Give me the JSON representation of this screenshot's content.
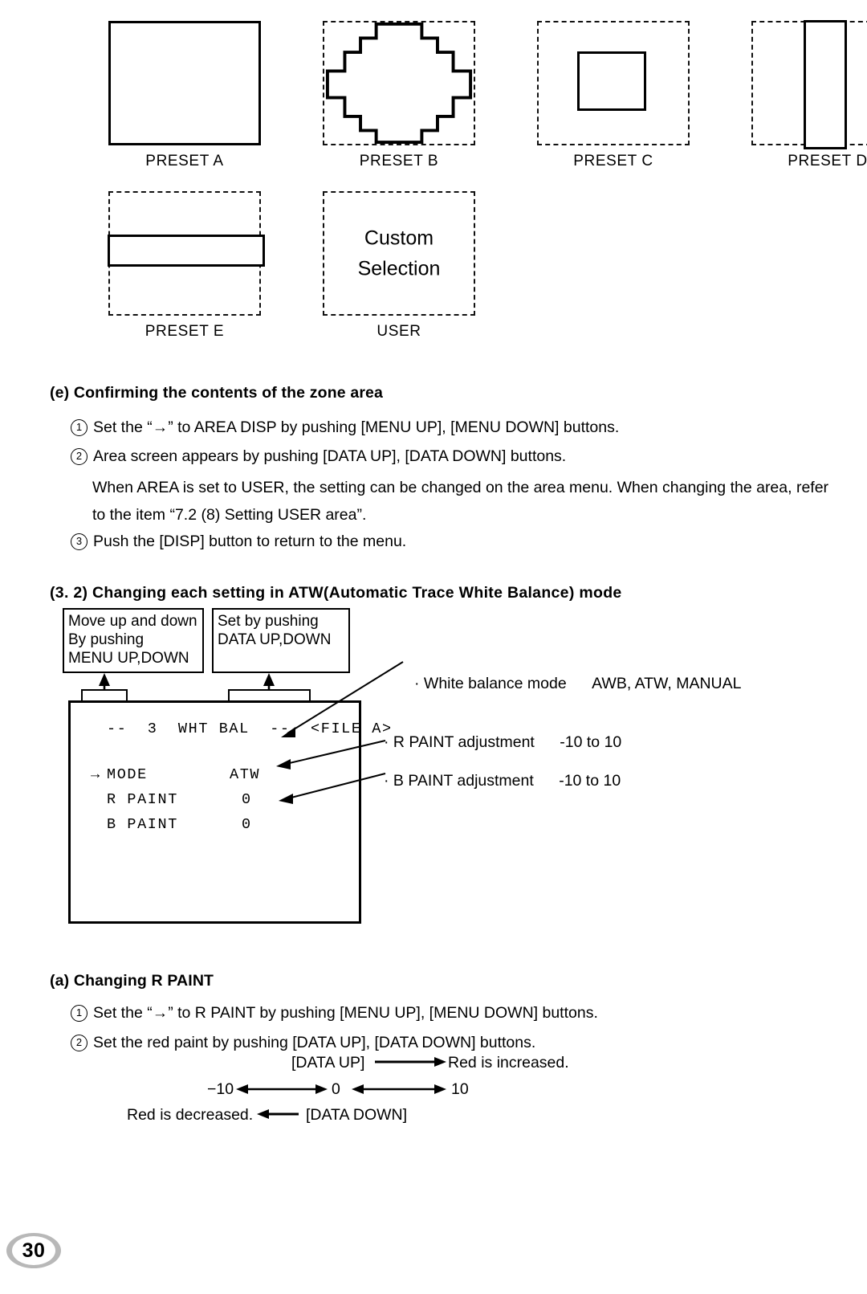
{
  "presets": {
    "row1": [
      {
        "label": "PRESET A",
        "shape": "full-frame"
      },
      {
        "label": "PRESET B",
        "shape": "stepped-octagon"
      },
      {
        "label": "PRESET C",
        "shape": "center-rect"
      },
      {
        "label": "PRESET D",
        "shape": "vertical-bar"
      }
    ],
    "row2": [
      {
        "label": "PRESET E",
        "shape": "horizontal-band"
      },
      {
        "label": "USER",
        "shape": "custom",
        "line1": "Custom",
        "line2": "Selection"
      }
    ]
  },
  "section_e": {
    "heading": "(e) Confirming the contents of the zone area",
    "items": [
      {
        "num": "1",
        "text": "Set the “→” to AREA DISP by pushing [MENU UP], [MENU DOWN] buttons."
      },
      {
        "num": "2",
        "text": "Area screen appears by pushing [DATA UP], [DATA DOWN] buttons."
      }
    ],
    "note_line1": "When AREA is set to USER, the setting can be changed on the area menu. When changing the area, refer",
    "note_line2": "to the item “7.2 (8) Setting USER area”.",
    "item3": {
      "num": "3",
      "text": "Push the [DISP] button to return to the menu."
    }
  },
  "section_32": {
    "heading": "(3. 2)  Changing each setting in ATW(Automatic Trace White Balance) mode",
    "callout_left": {
      "line1": "Move up and down",
      "line2": "By pushing",
      "line3": "MENU UP,DOWN"
    },
    "callout_right": {
      "line1": "Set by pushing",
      "line2": "DATA UP,DOWN"
    },
    "menu_screen": {
      "title": "--  3  WHT BAL  --  <FILE A>",
      "rows": [
        {
          "cursor": "→",
          "name": "MODE",
          "value": "ATW"
        },
        {
          "cursor": " ",
          "name": "R PAINT",
          "value": "0"
        },
        {
          "cursor": " ",
          "name": "B PAINT",
          "value": "0"
        }
      ]
    },
    "annotations": [
      {
        "bullet": "·",
        "label": "White balance mode",
        "value": "AWB, ATW, MANUAL"
      },
      {
        "bullet": "·",
        "label": "R PAINT adjustment",
        "value": "-10 to 10"
      },
      {
        "bullet": "·",
        "label": "B PAINT adjustment",
        "value": "-10 to 10"
      }
    ]
  },
  "section_a": {
    "heading": "(a) Changing R PAINT",
    "items": [
      {
        "num": "1",
        "text": "Set the “→” to R PAINT by pushing [MENU UP], [MENU DOWN] buttons."
      },
      {
        "num": "2",
        "text": "Set the red paint by pushing [DATA UP], [DATA DOWN] buttons."
      }
    ],
    "scale": {
      "up_label": "[DATA UP]",
      "up_result": "Red is increased.",
      "left_value": "−10",
      "center_value": "0",
      "right_value": "10",
      "down_result": "Red is decreased.",
      "down_label": "[DATA DOWN]"
    }
  },
  "page_number": "30"
}
